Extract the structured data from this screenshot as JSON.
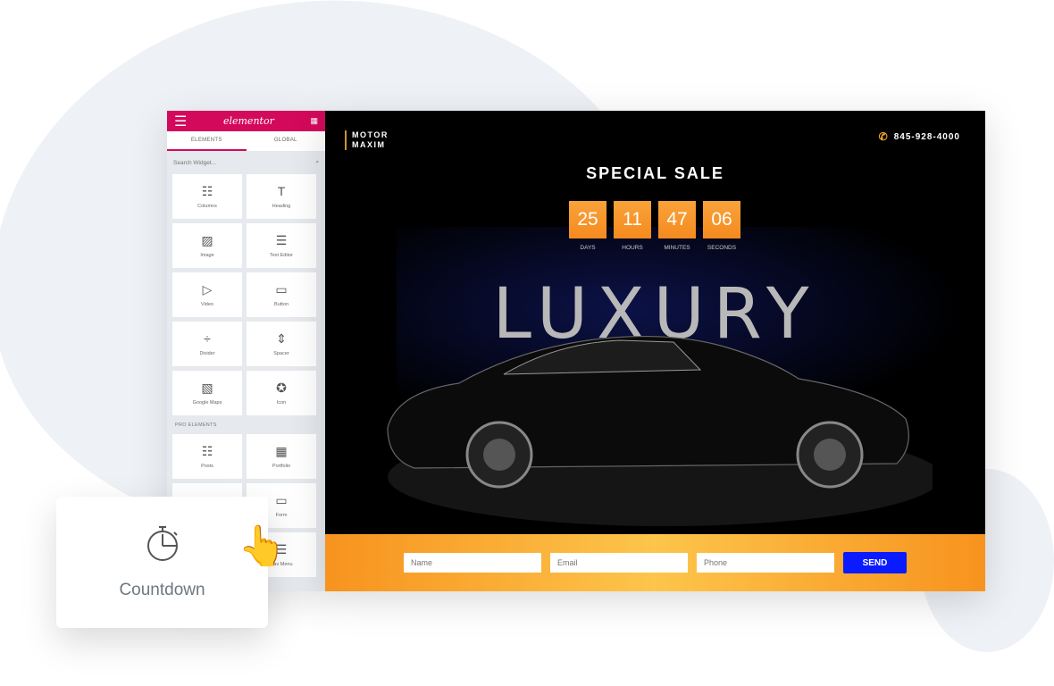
{
  "editor": {
    "logo": "elementor",
    "tabs": [
      {
        "label": "ELEMENTS",
        "active": true
      },
      {
        "label": "GLOBAL",
        "active": false
      }
    ],
    "search_placeholder": "Search Widget...",
    "widgets": [
      {
        "label": "Columns",
        "icon": "columns-icon",
        "glyph": "☷"
      },
      {
        "label": "Heading",
        "icon": "heading-icon",
        "glyph": "T"
      },
      {
        "label": "Image",
        "icon": "image-icon",
        "glyph": "▨"
      },
      {
        "label": "Text Editor",
        "icon": "text-editor-icon",
        "glyph": "☰"
      },
      {
        "label": "Video",
        "icon": "video-icon",
        "glyph": "▷"
      },
      {
        "label": "Button",
        "icon": "button-icon",
        "glyph": "▭"
      },
      {
        "label": "Divider",
        "icon": "divider-icon",
        "glyph": "÷"
      },
      {
        "label": "Spacer",
        "icon": "spacer-icon",
        "glyph": "⇕"
      },
      {
        "label": "Google Maps",
        "icon": "map-icon",
        "glyph": "▧"
      },
      {
        "label": "Icon",
        "icon": "star-icon",
        "glyph": "✪"
      }
    ],
    "pro_heading": "PRO ELEMENTS",
    "pro_widgets": [
      {
        "label": "Posts",
        "icon": "posts-icon",
        "glyph": "☷"
      },
      {
        "label": "Portfolio",
        "icon": "portfolio-icon",
        "glyph": "▦"
      },
      {
        "label": "",
        "icon": "countdown-icon",
        "glyph": ""
      },
      {
        "label": "Form",
        "icon": "form-icon",
        "glyph": "▭"
      },
      {
        "label": "",
        "icon": "blank-icon",
        "glyph": ""
      },
      {
        "label": "Nav Menu",
        "icon": "nav-menu-icon",
        "glyph": "☰"
      }
    ]
  },
  "site": {
    "brand_line1": "MOTOR",
    "brand_line2": "MAXIM",
    "phone": "845-928-4000",
    "title": "SPECIAL SALE",
    "countdown": [
      {
        "value": "25",
        "label": "DAYS"
      },
      {
        "value": "11",
        "label": "HOURS"
      },
      {
        "value": "47",
        "label": "MINUTES"
      },
      {
        "value": "06",
        "label": "SECONDS"
      }
    ],
    "hero_word": "LUXURY",
    "form": {
      "name_placeholder": "Name",
      "email_placeholder": "Email",
      "phone_placeholder": "Phone",
      "send_label": "SEND"
    },
    "accent": "#f7931e",
    "button_color": "#0a1cff"
  },
  "drag_card": {
    "label": "Countdown",
    "icon": "stopwatch-icon"
  },
  "colors": {
    "elementor": "#d3095b"
  }
}
